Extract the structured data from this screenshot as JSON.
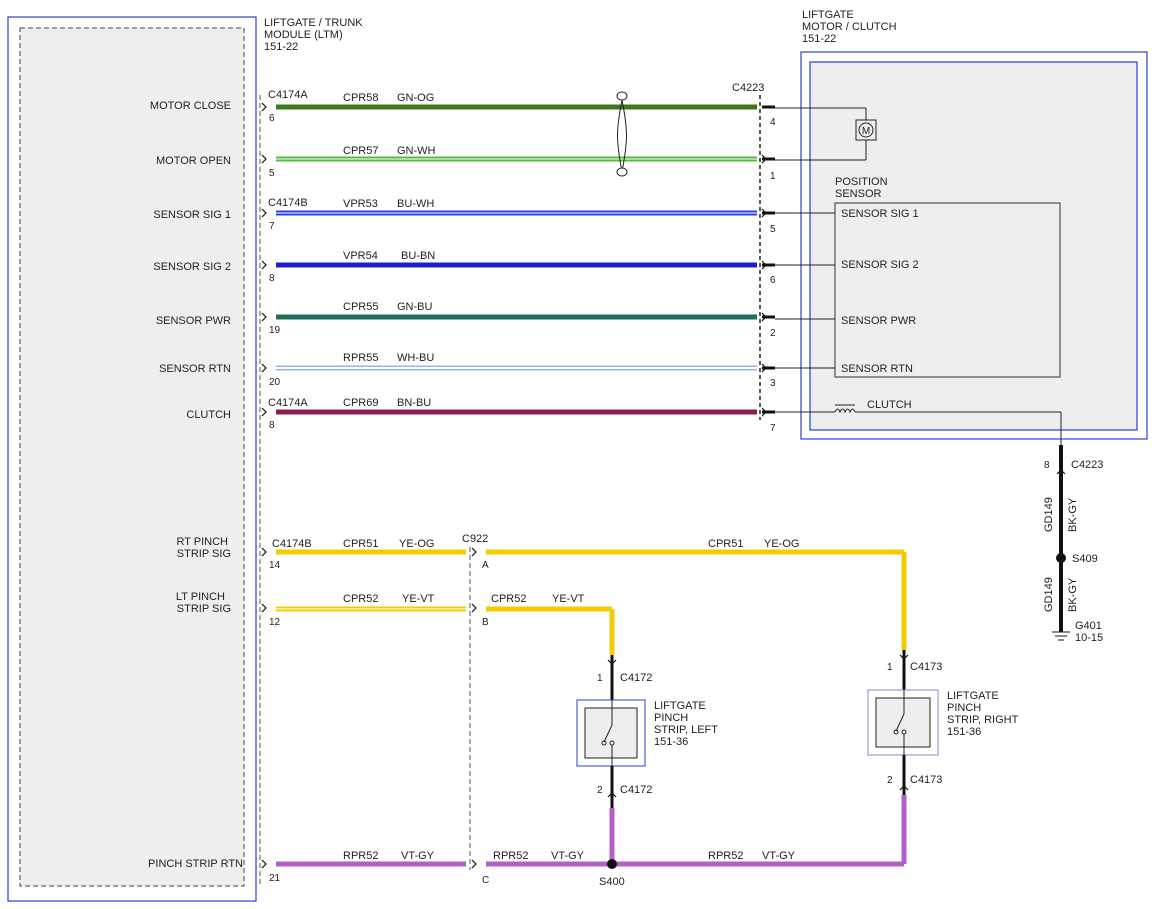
{
  "colors": {
    "GN-OG": "#3c7a1e",
    "GN-WH": "#57b840",
    "BU-WH": "#2f3fe0",
    "BU-BN": "#1e1ecf",
    "GN-BU": "#1f6f5c",
    "WH-BU": "#9ab4e8",
    "BN-BU": "#8b1d52",
    "YE-OG": "#f2cc00",
    "YE-VT": "#f2cc00",
    "VT-GY": "#b35fc7",
    "BK-GY": "#111111",
    "module_border": "#2b3fd6"
  },
  "ltm": {
    "title_lines": [
      "LIFTGATE / TRUNK",
      "MODULE (LTM)",
      "151-22"
    ],
    "pins": [
      "MOTOR CLOSE",
      "MOTOR OPEN",
      "SENSOR SIG 1",
      "SENSOR SIG 2",
      "SENSOR PWR",
      "SENSOR RTN",
      "CLUTCH"
    ],
    "pins2": [
      "RT PINCH",
      "STRIP SIG",
      "LT PINCH",
      "STRIP SIG",
      "PINCH STRIP RTN"
    ]
  },
  "motor": {
    "title_lines": [
      "LIFTGATE",
      "MOTOR / CLUTCH",
      "151-22"
    ],
    "sensor_title": [
      "POSITION",
      "SENSOR"
    ],
    "sensor_pins": [
      "SENSOR SIG 1",
      "SENSOR SIG 2",
      "SENSOR PWR",
      "SENSOR RTN"
    ],
    "clutch": "CLUTCH",
    "motor_symbol": "M"
  },
  "connectors": {
    "c4174a_1": "C4174A",
    "c4174b_1": "C4174B",
    "c4174a_2": "C4174A",
    "c4174b_2": "C4174B",
    "c4223": "C4223",
    "c4223_2": "C4223",
    "c922": "C922",
    "c4172_1": "C4172",
    "c4172_2": "C4172",
    "c4173_1": "C4173",
    "c4173_2": "C4173"
  },
  "wires": [
    {
      "circuit": "CPR58",
      "color": "GN-OG",
      "pin_l": "6",
      "pin_r": "4"
    },
    {
      "circuit": "CPR57",
      "color": "GN-WH",
      "pin_l": "5",
      "pin_r": "1"
    },
    {
      "circuit": "VPR53",
      "color": "BU-WH",
      "pin_l": "7",
      "pin_r": "5"
    },
    {
      "circuit": "VPR54",
      "color": "BU-BN",
      "pin_l": "8",
      "pin_r": "6"
    },
    {
      "circuit": "CPR55",
      "color": "GN-BU",
      "pin_l": "19",
      "pin_r": "2"
    },
    {
      "circuit": "RPR55",
      "color": "WH-BU",
      "pin_l": "20",
      "pin_r": "3"
    },
    {
      "circuit": "CPR69",
      "color": "BN-BU",
      "pin_l": "8",
      "pin_r": "7"
    }
  ],
  "pinch": {
    "rt": {
      "circuit": "CPR51",
      "color": "YE-OG",
      "pin_l": "14",
      "pin_c": "A",
      "circuit2": "CPR51",
      "color2": "YE-OG"
    },
    "lt": {
      "circuit": "CPR52",
      "color": "YE-VT",
      "pin_l": "12",
      "pin_c": "B",
      "circuit2": "CPR52",
      "color2": "YE-VT"
    },
    "rtn": {
      "circuit": "RPR52",
      "color": "VT-GY",
      "pin_l": "21",
      "pin_c": "C",
      "circuit2": "RPR52",
      "color2": "VT-GY",
      "circuit3": "RPR52",
      "color3": "VT-GY"
    },
    "left_strip": [
      "LIFTGATE",
      "PINCH",
      "STRIP, LEFT",
      "151-36"
    ],
    "right_strip": [
      "LIFTGATE",
      "PINCH",
      "STRIP, RIGHT",
      "151-36"
    ],
    "left_pin_top": "1",
    "left_pin_bot": "2",
    "right_pin_top": "1",
    "right_pin_bot": "2",
    "splice": "S400"
  },
  "ground": {
    "pin": "8",
    "wire1": "GD149",
    "color1": "BK-GY",
    "splice": "S409",
    "wire2": "GD149",
    "color2": "BK-GY",
    "ground_id": "G401",
    "ground_ref": "10-15"
  }
}
